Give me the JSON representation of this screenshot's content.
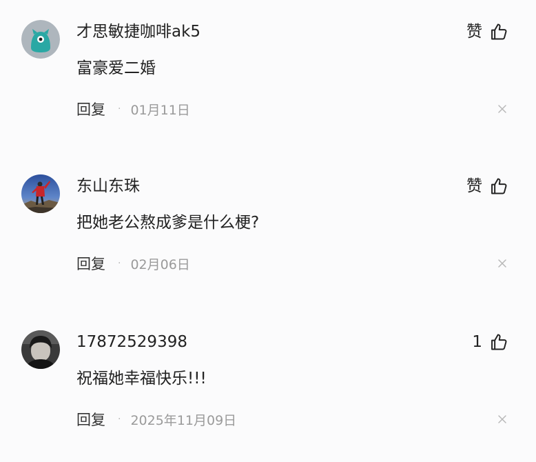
{
  "comments": [
    {
      "username": "才思敏捷咖啡ak5",
      "content": "富豪爱二婚",
      "like_label": "赞",
      "reply_label": "回复",
      "separator": "·",
      "date": "01月11日",
      "avatar_icon": "cartoon-teal-avatar",
      "avatar_color": "#2aa8a4"
    },
    {
      "username": "东山东珠",
      "content": "把她老公熬成爹是什么梗?",
      "like_label": "赞",
      "reply_label": "回复",
      "separator": "·",
      "date": "02月06日",
      "avatar_icon": "person-red-jacket-avatar",
      "avatar_color": "#c8262b"
    },
    {
      "username": "17872529398",
      "content": "祝福她幸福快乐!!!",
      "like_label": "1",
      "reply_label": "回复",
      "separator": "·",
      "date": "2025年11月09日",
      "avatar_icon": "dark-portrait-avatar",
      "avatar_color": "#3a3a3a"
    }
  ]
}
